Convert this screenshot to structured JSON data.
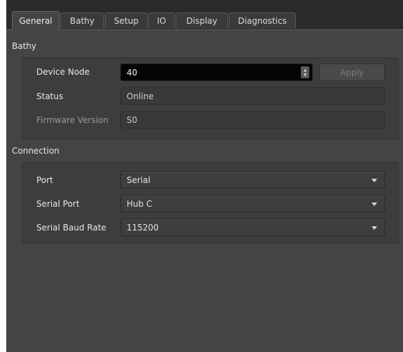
{
  "tabs": [
    {
      "label": "General",
      "active": true
    },
    {
      "label": "Bathy",
      "active": false
    },
    {
      "label": "Setup",
      "active": false
    },
    {
      "label": "IO",
      "active": false
    },
    {
      "label": "Display",
      "active": false
    },
    {
      "label": "Diagnostics",
      "active": false
    }
  ],
  "bathy": {
    "title": "Bathy",
    "device_node_label": "Device Node",
    "device_node_value": "40",
    "apply_label": "Apply",
    "status_label": "Status",
    "status_value": "Online",
    "firmware_label": "Firmware Version",
    "firmware_value": "S0"
  },
  "connection": {
    "title": "Connection",
    "port_label": "Port",
    "port_value": "Serial",
    "serial_port_label": "Serial Port",
    "serial_port_value": "Hub C",
    "baud_label": "Serial Baud Rate",
    "baud_value": "115200"
  }
}
